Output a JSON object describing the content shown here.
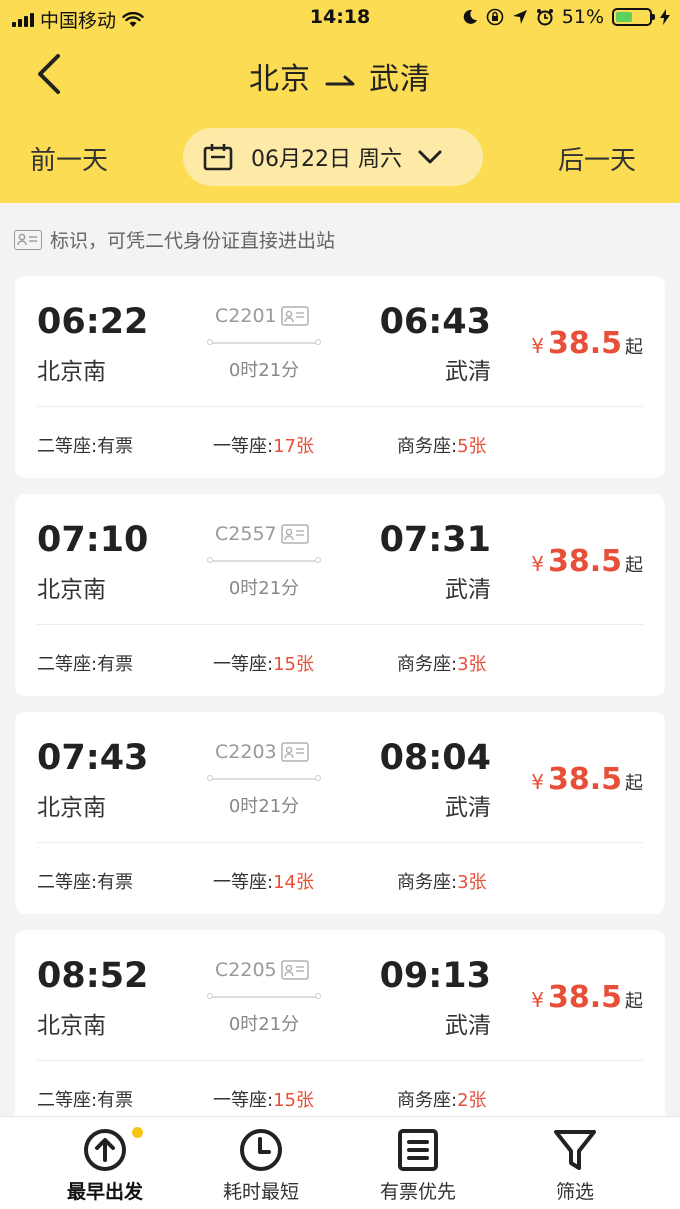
{
  "status_bar": {
    "carrier": "中国移动",
    "time": "14:18",
    "battery": "51%",
    "battery_level": 0.51
  },
  "header": {
    "from": "北京",
    "to": "武清",
    "prev_day": "前一天",
    "next_day": "后一天",
    "date": "06月22日 周六"
  },
  "notice": "标识，可凭二代身份证直接进出站",
  "trains": [
    {
      "dep_time": "06:22",
      "dep_station": "北京南",
      "train_no": "C2201",
      "duration": "0时21分",
      "arr_time": "06:43",
      "arr_station": "武清",
      "price_symbol": "¥",
      "price": "38.5",
      "price_suffix": "起",
      "seats": [
        {
          "name": "二等座:",
          "avail": "有票",
          "highlight": false
        },
        {
          "name": "一等座:",
          "avail": "17张",
          "highlight": true
        },
        {
          "name": "商务座:",
          "avail": "5张",
          "highlight": true
        }
      ]
    },
    {
      "dep_time": "07:10",
      "dep_station": "北京南",
      "train_no": "C2557",
      "duration": "0时21分",
      "arr_time": "07:31",
      "arr_station": "武清",
      "price_symbol": "¥",
      "price": "38.5",
      "price_suffix": "起",
      "seats": [
        {
          "name": "二等座:",
          "avail": "有票",
          "highlight": false
        },
        {
          "name": "一等座:",
          "avail": "15张",
          "highlight": true
        },
        {
          "name": "商务座:",
          "avail": "3张",
          "highlight": true
        }
      ]
    },
    {
      "dep_time": "07:43",
      "dep_station": "北京南",
      "train_no": "C2203",
      "duration": "0时21分",
      "arr_time": "08:04",
      "arr_station": "武清",
      "price_symbol": "¥",
      "price": "38.5",
      "price_suffix": "起",
      "seats": [
        {
          "name": "二等座:",
          "avail": "有票",
          "highlight": false
        },
        {
          "name": "一等座:",
          "avail": "14张",
          "highlight": true
        },
        {
          "name": "商务座:",
          "avail": "3张",
          "highlight": true
        }
      ]
    },
    {
      "dep_time": "08:52",
      "dep_station": "北京南",
      "train_no": "C2205",
      "duration": "0时21分",
      "arr_time": "09:13",
      "arr_station": "武清",
      "price_symbol": "¥",
      "price": "38.5",
      "price_suffix": "起",
      "seats": [
        {
          "name": "二等座:",
          "avail": "有票",
          "highlight": false
        },
        {
          "name": "一等座:",
          "avail": "15张",
          "highlight": true
        },
        {
          "name": "商务座:",
          "avail": "2张",
          "highlight": true
        }
      ]
    }
  ],
  "tabbar": [
    {
      "label": "最早出发",
      "icon": "arrow-up-circle-icon",
      "active": true
    },
    {
      "label": "耗时最短",
      "icon": "clock-icon",
      "active": false
    },
    {
      "label": "有票优先",
      "icon": "list-box-icon",
      "active": false
    },
    {
      "label": "筛选",
      "icon": "filter-icon",
      "active": false
    }
  ],
  "colors": {
    "brand_yellow": "#fbdc52",
    "date_pill": "#fdeaa6",
    "price_red": "#e84f38",
    "active_dot": "#f5c518"
  }
}
